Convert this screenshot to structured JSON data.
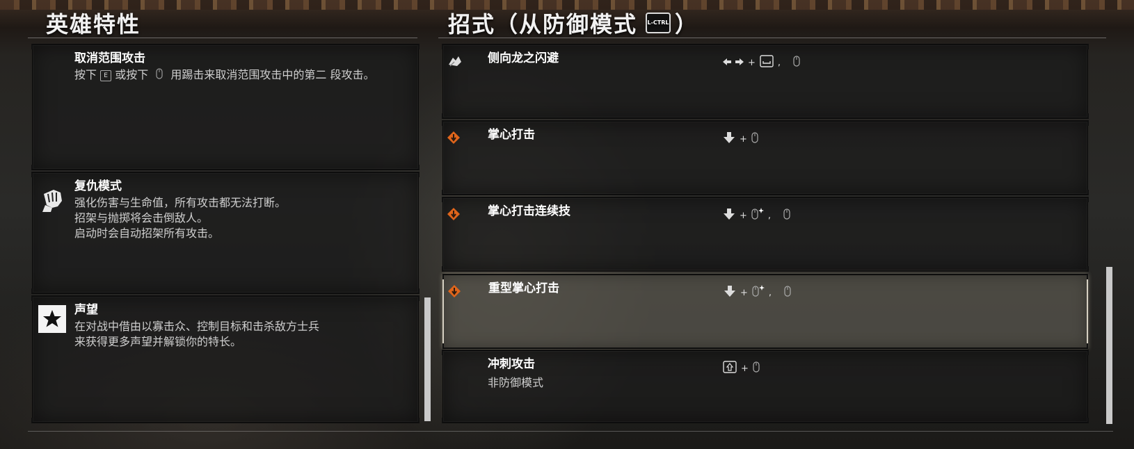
{
  "headers": {
    "traits_title": "英雄特性",
    "moves_title_prefix": "招式（从防御模式",
    "moves_title_key": "L-CTRL",
    "moves_title_suffix": "）"
  },
  "traits": [
    {
      "name": "取消范围攻击",
      "desc_part1": "按下",
      "key": "E",
      "desc_part2": "或按下",
      "desc_part3": "用踢击来取消范围攻击中的第二",
      "desc_part4": "段攻击。",
      "icon": "none"
    },
    {
      "name": "复仇模式",
      "desc": "强化伤害与生命值，所有攻击都无法打断。\n招架与抛掷将会击倒敌人。\n启动时会自动招架所有攻击。",
      "icon": "fist-icon"
    },
    {
      "name": "声望",
      "desc": "在对战中借由以寡击众、控制目标和击杀敌方士兵\n来获得更多声望并解锁你的特长。",
      "icon": "star-icon"
    }
  ],
  "moves": [
    {
      "name": "侧向龙之闪避",
      "subtitle": "",
      "icon": "dodge-icon",
      "combo": [
        "left-arrow",
        "right-arrow",
        "plus",
        "spacebar",
        "comma",
        "mouse"
      ],
      "selected": false
    },
    {
      "name": "掌心打击",
      "subtitle": "",
      "icon": "unblockable-icon",
      "combo": [
        "down-arrow",
        "plus",
        "mouse"
      ],
      "selected": false
    },
    {
      "name": "掌心打击连续技",
      "subtitle": "",
      "icon": "unblockable-icon",
      "combo": [
        "down-arrow",
        "plus",
        "mouse-sparkle",
        "comma",
        "mouse"
      ],
      "selected": false
    },
    {
      "name": "重型掌心打击",
      "subtitle": "",
      "icon": "unblockable-icon",
      "combo": [
        "down-arrow",
        "plus",
        "mouse-sparkle",
        "comma",
        "mouse"
      ],
      "selected": true
    },
    {
      "name": "冲刺攻击",
      "subtitle": "非防御模式",
      "icon": "none",
      "combo": [
        "shift",
        "plus",
        "mouse"
      ],
      "selected": false
    }
  ],
  "combo_symbols": {
    "plus": "+",
    "comma": ","
  },
  "colors": {
    "accent_orange": "#e0651b",
    "selected_border": "#d6d0c2"
  }
}
